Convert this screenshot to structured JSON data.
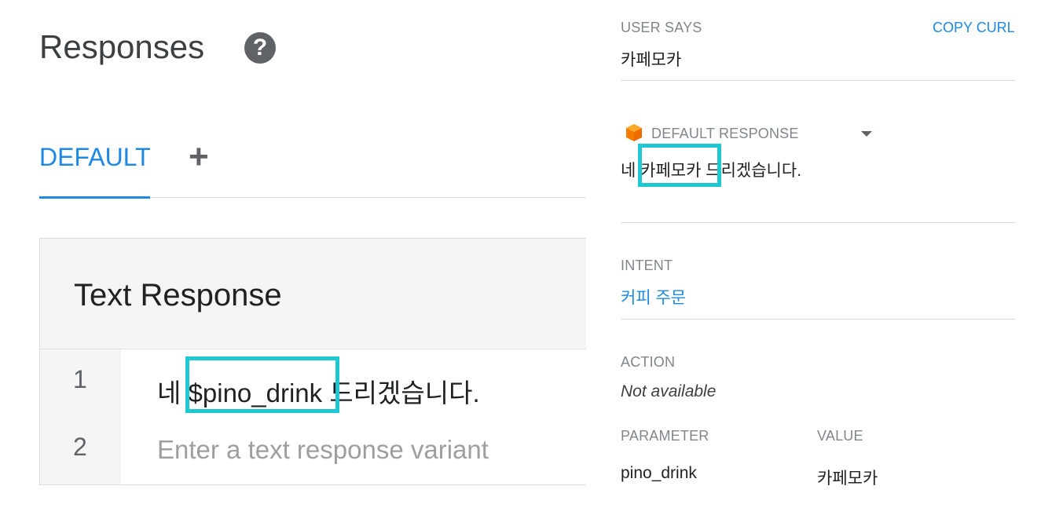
{
  "responses_panel": {
    "title": "Responses",
    "help_icon": "question-circle-icon",
    "tabs": [
      {
        "label": "DEFAULT",
        "active": true
      }
    ],
    "add_tab_icon": "plus-icon",
    "add_tab_glyph": "+",
    "card_title": "Text Response",
    "rows": [
      {
        "index": "1",
        "text_prefix": "네 ",
        "param": "$pino_drink",
        "text_suffix": " 드리겠습니다."
      },
      {
        "index": "2",
        "placeholder": "Enter a text response variant"
      }
    ]
  },
  "console": {
    "user_says_label": "USER SAYS",
    "copy_curl_label": "COPY CURL",
    "user_says_value": "카페모카",
    "default_response_label": "DEFAULT RESPONSE",
    "default_response_icon": "orange-cube-icon",
    "default_response_value": "네 카페모카 드리겠습니다.",
    "intent_label": "INTENT",
    "intent_value": "커피 주문",
    "action_label": "ACTION",
    "action_value": "Not available",
    "parameter_header": "PARAMETER",
    "value_header": "VALUE",
    "parameters": [
      {
        "name": "pino_drink",
        "value": "카페모카"
      }
    ]
  },
  "colors": {
    "accent": "#1e88e5",
    "highlight_box": "#1ec8d2",
    "cube_orange": "#f57c00"
  }
}
